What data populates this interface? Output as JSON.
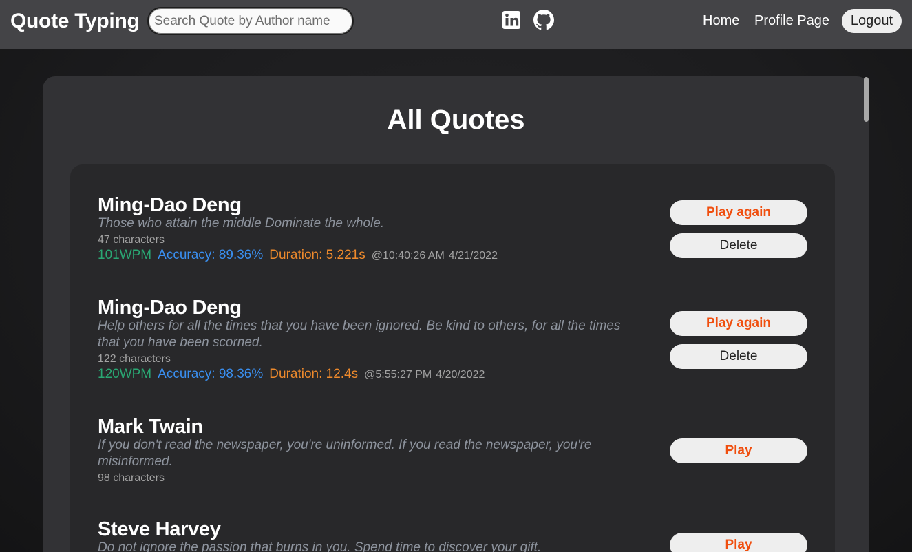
{
  "navbar": {
    "brand": "Quote Typing",
    "search_placeholder": "Search Quote by Author name",
    "social_icons": [
      "linkedin-icon",
      "github-icon"
    ],
    "links": {
      "home": "Home",
      "profile": "Profile Page"
    },
    "logout": "Logout"
  },
  "page": {
    "title": "All Quotes"
  },
  "colors": {
    "wpm": "#2aa773",
    "accuracy": "#3a8ff0",
    "duration": "#ee8a2c",
    "play_button_text": "#f04e0e"
  },
  "quotes": [
    {
      "author": "Ming-Dao Deng",
      "text": "Those who attain the middle Dominate the whole.",
      "characters": "47 characters",
      "wpm": "101WPM",
      "accuracy": "Accuracy: 89.36%",
      "duration": "Duration: 5.221s",
      "time": "@10:40:26 AM",
      "date": "4/21/2022",
      "play_label": "Play again",
      "delete_label": "Delete"
    },
    {
      "author": "Ming-Dao Deng",
      "text": "Help others for all the times that you have been ignored. Be kind to others, for all the times that you have been scorned.",
      "characters": "122 characters",
      "wpm": "120WPM",
      "accuracy": "Accuracy: 98.36%",
      "duration": "Duration: 12.4s",
      "time": "@5:55:27 PM",
      "date": "4/20/2022",
      "play_label": "Play again",
      "delete_label": "Delete"
    },
    {
      "author": "Mark Twain",
      "text": "If you don't read the newspaper, you're uninformed. If you read the newspaper, you're misinformed.",
      "characters": "98 characters",
      "play_label": "Play"
    },
    {
      "author": "Steve Harvey",
      "text": "Do not ignore the passion that burns in you. Spend time to discover your gift.",
      "play_label": "Play"
    }
  ]
}
